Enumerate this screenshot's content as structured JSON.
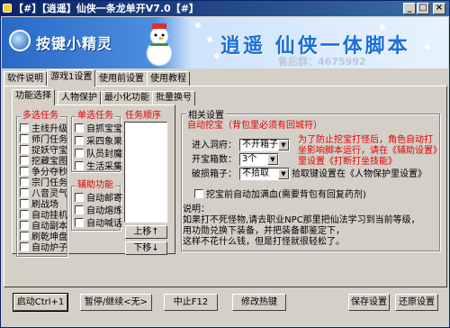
{
  "window": {
    "title": "【#】【逍遥】仙侠一条龙单开V7.0【#】",
    "minimize": "_",
    "maximize": "□",
    "close": "×"
  },
  "banner": {
    "logo_text": "按键小精灵",
    "slogan": "逍遥 仙侠一体脚本",
    "qq": "售后群：4675992"
  },
  "main_tabs": [
    "软件说明",
    "游戏1设置",
    "使用前设置",
    "使用教程"
  ],
  "sub_tabs": [
    "功能选择",
    "人物保护",
    "最小化功能",
    "批量换号"
  ],
  "multi_task": {
    "title": "多选任务",
    "items": [
      "主线升级",
      "师门任务",
      "捉妖守宝",
      "挖藏宝图",
      "争分夺秒",
      "宗门任务",
      "八音灵气",
      "刷战场",
      "自动挂机",
      "自动副本",
      "刷乾坤盘",
      "自动炉子"
    ]
  },
  "single_task": {
    "title": "单选任务",
    "items": [
      "自抓宝宝",
      "采四象果",
      "队员封魔",
      "生活采集"
    ]
  },
  "assist": {
    "title": "辅助功能",
    "items": [
      "自动邮寄",
      "自动熔炼",
      "自动喊话"
    ]
  },
  "task_order": {
    "title": "任务顺序",
    "up": "上移↑",
    "down": "下移↓"
  },
  "related": {
    "title": "相关设置",
    "auto_dig": "自动挖宝（背包里必须有回城符）",
    "note": "为了防止挖宝打怪后，角色自动打坐影响脚本运行，请在《辅助设置》里设置《打断打坐技能》",
    "enter_cave_label": "进入洞府：",
    "enter_cave_value": "不开箱子",
    "open_box_label": "开宝箱数：",
    "open_box_value": "3个",
    "break_box_label": "破损箱子：",
    "break_box_value": "不拾取",
    "pickup_note": "拾取键设置在《人物保护里设置》",
    "auto_pair": "挖宝前自动加满血(需要背包有回复药剂)",
    "desc_title": "说明：",
    "desc_lines": [
      "如果打不死怪物,请去职业NPC那里把仙法学习到当前等级，",
      "用功勋兑换下装备，并把装备都鉴定下，",
      "这样不花什么钱，但是打怪就很轻松了。"
    ]
  },
  "bottom_buttons": {
    "start": "启动Ctrl+1",
    "pause": "暂停/继续<无>",
    "stop": "中止F12",
    "hotkey": "修改热键",
    "save": "保存设置",
    "restore": "还原设置"
  }
}
